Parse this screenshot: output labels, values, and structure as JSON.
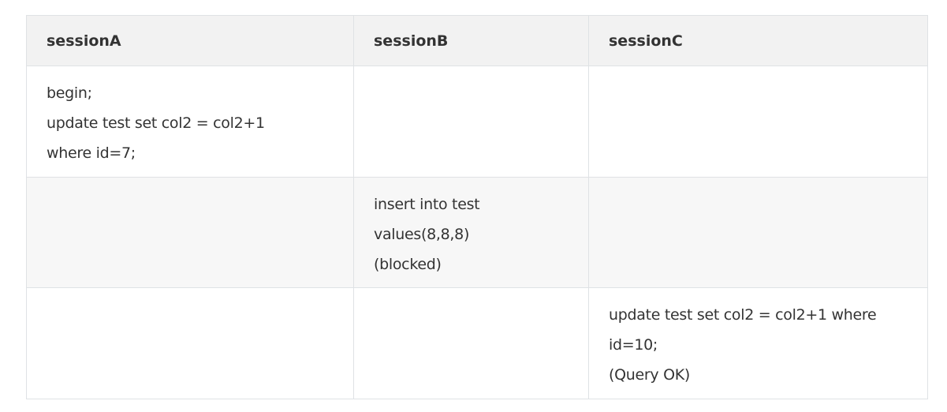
{
  "table": {
    "headers": [
      "sessionA",
      "sessionB",
      "sessionC"
    ],
    "rows": [
      [
        [
          "begin;",
          "update test set col2 = col2+1",
          "where id=7;"
        ],
        [],
        []
      ],
      [
        [],
        [
          "insert into test",
          "values(8,8,8)",
          "(blocked)"
        ],
        []
      ],
      [
        [],
        [],
        [
          "update test set col2 = col2+1 where",
          "id=10;",
          "(Query OK)"
        ]
      ]
    ]
  }
}
